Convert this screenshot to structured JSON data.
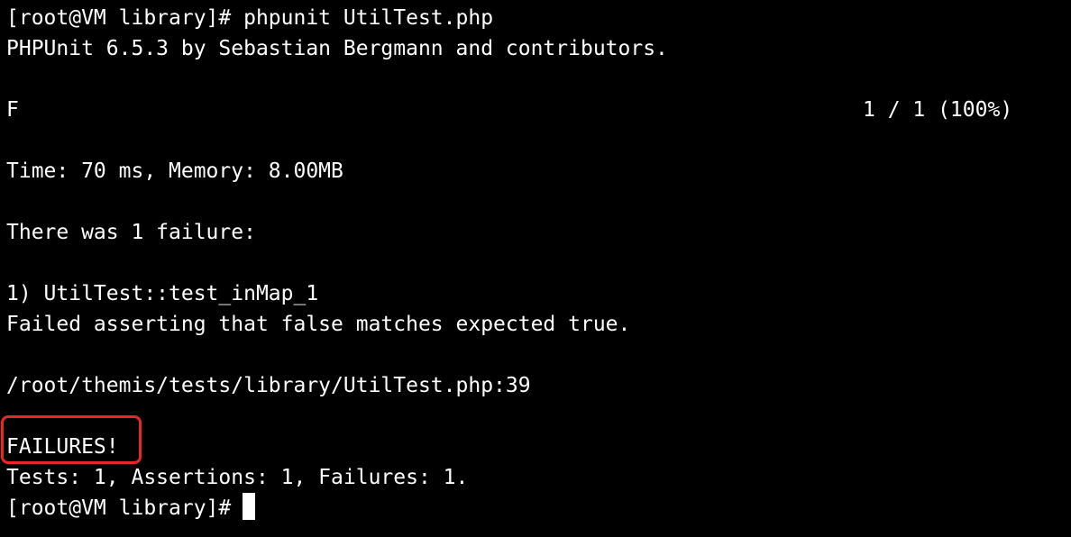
{
  "terminal": {
    "command_line": "[root@VM library]# phpunit UtilTest.php",
    "version_line": "PHPUnit 6.5.3 by Sebastian Bergmann and contributors.",
    "progress_dots": "F",
    "progress_count": "1 / 1 (100%)",
    "time_memory": "Time: 70 ms, Memory: 8.00MB",
    "failure_header": "There was 1 failure:",
    "failure_name": "1) UtilTest::test_inMap_1",
    "failure_message": "Failed asserting that false matches expected true.",
    "failure_location": "/root/themis/tests/library/UtilTest.php:39",
    "failures_banner": "FAILURES!",
    "summary": "Tests: 1, Assertions: 1, Failures: 1.",
    "prompt": "[root@VM library]#"
  },
  "colors": {
    "background": "#000000",
    "text": "#ffffff",
    "highlight_border": "#e8262a"
  }
}
